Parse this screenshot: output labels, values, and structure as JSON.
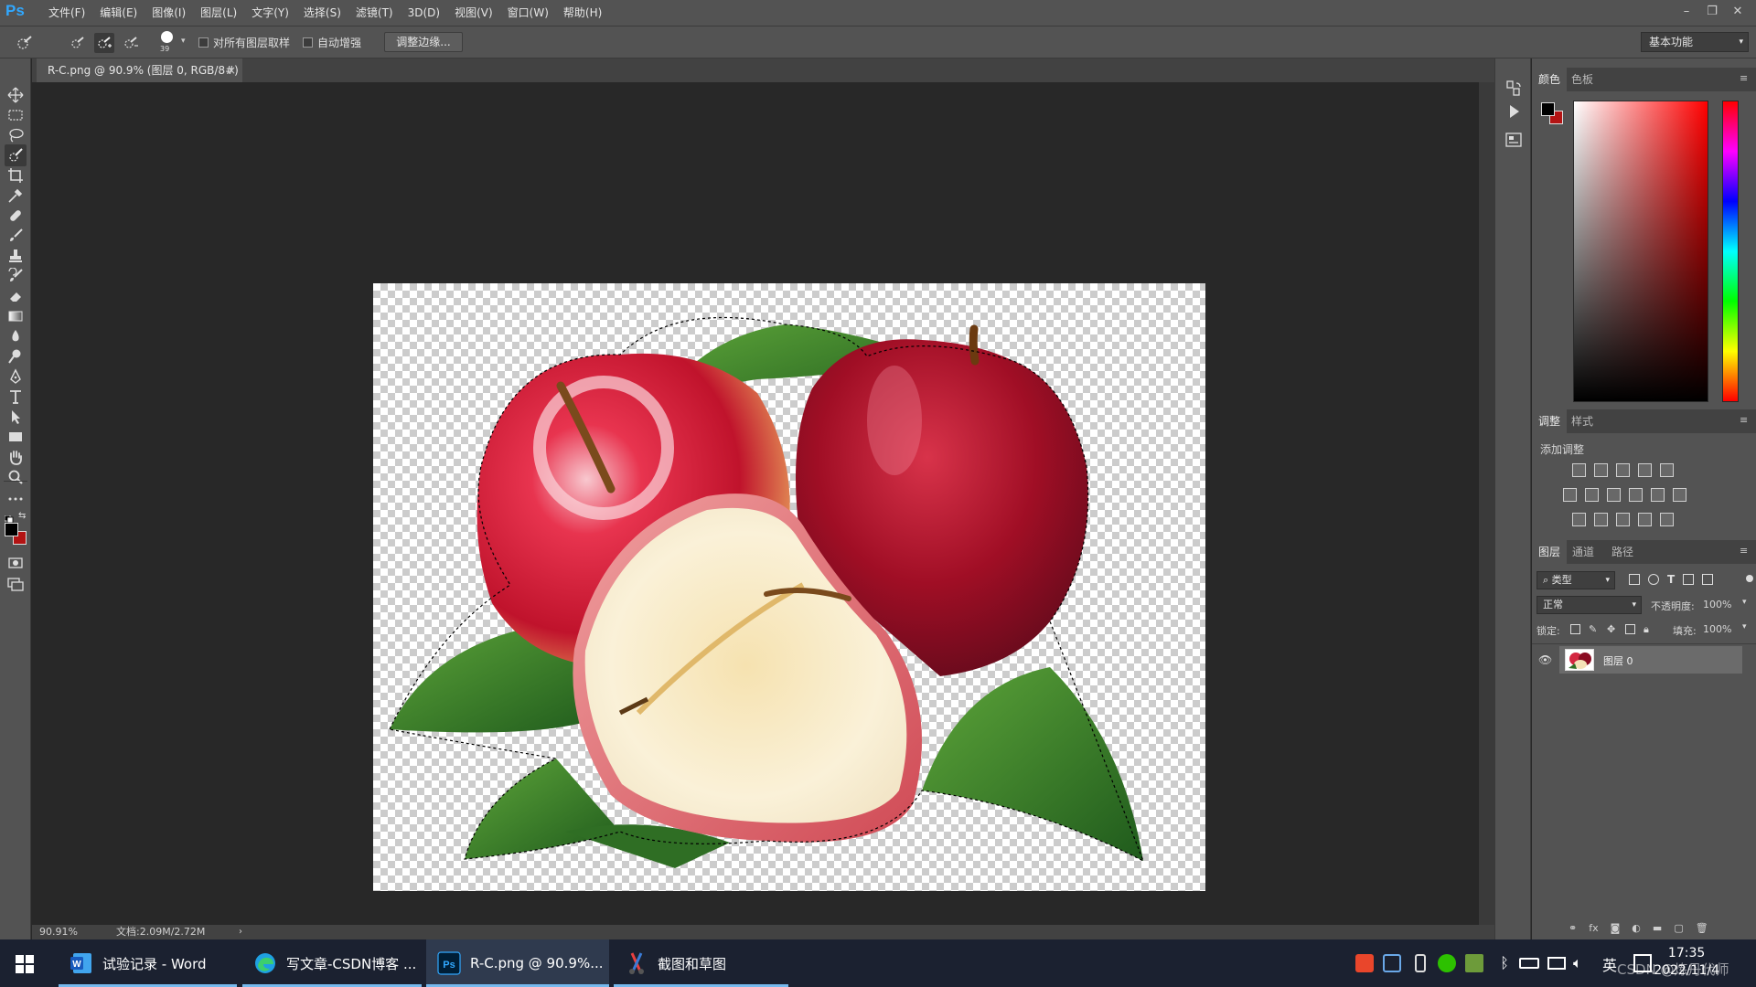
{
  "app": {
    "logo": "Ps"
  },
  "menu": [
    "文件(F)",
    "编辑(E)",
    "图像(I)",
    "图层(L)",
    "文字(Y)",
    "选择(S)",
    "滤镜(T)",
    "3D(D)",
    "视图(V)",
    "窗口(W)",
    "帮助(H)"
  ],
  "window_controls": {
    "minimize": "–",
    "restore": "❐",
    "close": "✕"
  },
  "options": {
    "brush_size": "39",
    "sample_all_layers": "对所有图层取样",
    "auto_enhance": "自动增强",
    "refine_edge": "调整边缘...",
    "workspace": "基本功能"
  },
  "document": {
    "tab_title": "R-C.png @ 90.9% (图层 0, RGB/8#)",
    "close": "×",
    "zoom": "90.91%",
    "doc_info": "文档:2.09M/2.72M"
  },
  "panels": {
    "color_tabs": [
      "颜色",
      "色板"
    ],
    "adjust_tabs": [
      "调整",
      "样式"
    ],
    "add_adjustment": "添加调整",
    "layers_tabs": [
      "图层",
      "通道",
      "路径"
    ],
    "filter_kind": "类型",
    "blend_mode": "正常",
    "opacity_label": "不透明度:",
    "opacity_value": "100%",
    "lock_label": "锁定:",
    "fill_label": "填充:",
    "fill_value": "100%",
    "layer_name": "图层 0"
  },
  "taskbar": {
    "items": [
      {
        "label": "试验记录 - Word",
        "icon": "word-icon"
      },
      {
        "label": "写文章-CSDN博客 ...",
        "icon": "edge-icon"
      },
      {
        "label": "R-C.png @ 90.9%...",
        "icon": "photoshop-icon"
      },
      {
        "label": "截图和草图",
        "icon": "snip-icon"
      }
    ],
    "ime": "英",
    "time": "17:35",
    "date": "2022/11/4",
    "watermark": "CSDN @炼丹代师"
  },
  "colors": {
    "foreground": "#000000",
    "background": "#b31414",
    "accent": "#31a8ff"
  }
}
